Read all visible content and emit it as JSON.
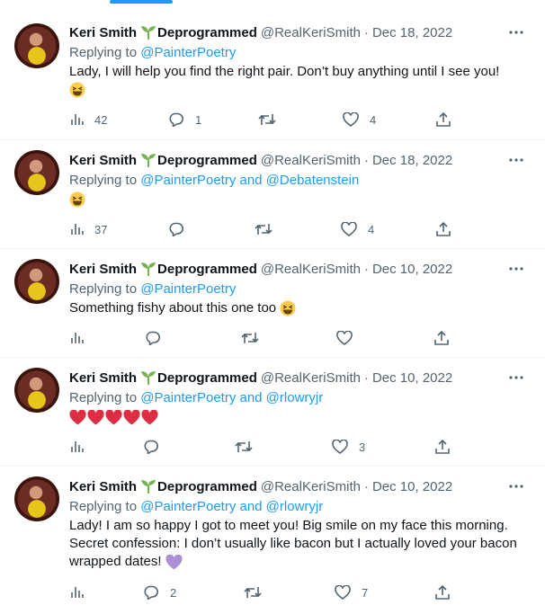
{
  "tweets": [
    {
      "name": "Keri Smith",
      "badge_text": "Deprogrammed",
      "handle": "@RealKeriSmith",
      "dot": "·",
      "date": "Dec 18, 2022",
      "reply_prefix": "Replying to",
      "mentions": "@PainterPoetry",
      "text": "Lady, I will help you find the right pair. Don’t buy anything until I see you!",
      "views": "42",
      "replies": "1",
      "retweets": "",
      "likes": "4"
    },
    {
      "name": "Keri Smith",
      "badge_text": "Deprogrammed",
      "handle": "@RealKeriSmith",
      "dot": "·",
      "date": "Dec 18, 2022",
      "reply_prefix": "Replying to",
      "mentions": "@PainterPoetry and @Debatenstein",
      "text": "",
      "views": "37",
      "replies": "",
      "retweets": "",
      "likes": "4"
    },
    {
      "name": "Keri Smith",
      "badge_text": "Deprogrammed",
      "handle": "@RealKeriSmith",
      "dot": "·",
      "date": "Dec 10, 2022",
      "reply_prefix": "Replying to",
      "mentions": "@PainterPoetry",
      "text": "Something fishy about this one too",
      "views": "",
      "replies": "",
      "retweets": "",
      "likes": ""
    },
    {
      "name": "Keri Smith",
      "badge_text": "Deprogrammed",
      "handle": "@RealKeriSmith",
      "dot": "·",
      "date": "Dec 10, 2022",
      "reply_prefix": "Replying to",
      "mentions": "@PainterPoetry and @rlowryjr",
      "text": "",
      "views": "",
      "replies": "",
      "retweets": "",
      "likes": "3"
    },
    {
      "name": "Keri Smith",
      "badge_text": "Deprogrammed",
      "handle": "@RealKeriSmith",
      "dot": "·",
      "date": "Dec 10, 2022",
      "reply_prefix": "Replying to",
      "mentions": "@PainterPoetry and @rlowryjr",
      "text": "Lady! I am so happy I got to meet you! Big smile on my face this morning. Secret confession: I don’t usually like bacon but I actually loved your bacon wrapped dates!",
      "views": "",
      "replies": "2",
      "retweets": "",
      "likes": "7"
    }
  ],
  "colors": {
    "accent": "#1d9bf0",
    "muted": "#536471",
    "heart_red": "#dd2e44",
    "heart_purple": "#aa8ed6",
    "sprout_green": "#77b255"
  }
}
